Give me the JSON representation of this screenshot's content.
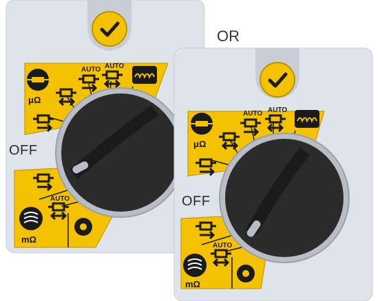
{
  "separator_text": "OR",
  "colors": {
    "face": "#dfe3ea",
    "yellow": "#f4c200",
    "black": "#1b1b1b",
    "knob": "#2b2b2b",
    "knob_edge": "#b9bec6"
  },
  "panels": [
    {
      "id": "panel-a",
      "ok_button_icon": "checkmark-icon",
      "off_label": "OFF",
      "upper_segment": [
        {
          "icon": "resistor-icon",
          "text": "μΩ"
        },
        {
          "icon": "continuity-icon",
          "text": ""
        },
        {
          "icon": "continuity-auto-icon",
          "text": "AUTO"
        },
        {
          "icon": "continuity-auto-icon",
          "text": "AUTO"
        },
        {
          "icon": "coil-icon",
          "text": ""
        },
        {
          "icon": "continuity-icon",
          "text": ""
        }
      ],
      "lower_segment": [
        {
          "icon": "continuity-icon",
          "text": ""
        },
        {
          "icon": "continuity-auto-icon",
          "text": "AUTO"
        },
        {
          "icon": "earth-icon",
          "text": "mΩ"
        },
        {
          "icon": "gear-icon",
          "text": ""
        }
      ]
    },
    {
      "id": "panel-b",
      "ok_button_icon": "checkmark-icon",
      "off_label": "OFF",
      "upper_segment": [
        {
          "icon": "resistor-icon",
          "text": "μΩ"
        },
        {
          "icon": "continuity-icon",
          "text": ""
        },
        {
          "icon": "continuity-auto-icon",
          "text": "AUTO"
        },
        {
          "icon": "continuity-auto-icon",
          "text": "AUTO"
        },
        {
          "icon": "coil-icon",
          "text": ""
        },
        {
          "icon": "continuity-icon",
          "text": ""
        }
      ],
      "lower_segment": [
        {
          "icon": "continuity-icon",
          "text": ""
        },
        {
          "icon": "continuity-auto-icon",
          "text": "AUTO"
        },
        {
          "icon": "earth-icon",
          "text": "mΩ"
        },
        {
          "icon": "gear-icon",
          "text": ""
        }
      ]
    }
  ]
}
